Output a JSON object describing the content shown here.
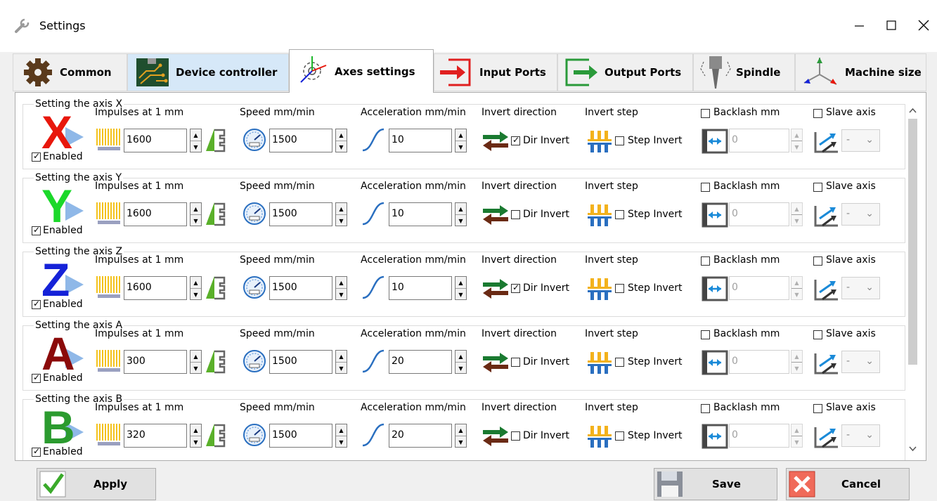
{
  "window": {
    "title": "Settings"
  },
  "tabs": [
    {
      "label": "Common",
      "icon": "gear-icon"
    },
    {
      "label": "Device controller",
      "icon": "circuit-board-icon"
    },
    {
      "label": "Axes settings",
      "icon": "axes-gear-icon"
    },
    {
      "label": "Input Ports",
      "icon": "input-arrow-icon"
    },
    {
      "label": "Output Ports",
      "icon": "output-arrow-icon"
    },
    {
      "label": "Spindle",
      "icon": "spindle-icon"
    },
    {
      "label": "Machine size",
      "icon": "machine-axes-icon"
    }
  ],
  "labels": {
    "impulses": "Impulses at 1 mm",
    "speed": "Speed mm/min",
    "acceleration": "Acceleration mm/min",
    "invert_direction": "Invert direction",
    "invert_step": "Invert step",
    "backlash": "Backlash mm",
    "slave": "Slave axis",
    "enabled": "Enabled",
    "dir_invert": "Dir Invert",
    "step_invert": "Step Invert"
  },
  "axes": [
    {
      "title": "Setting the axis X",
      "letter": "X",
      "color": "#e8170c",
      "enabled": true,
      "impulses": "1600",
      "speed": "1500",
      "acceleration": "10",
      "dir_invert": true,
      "step_invert": false,
      "backlash_checked": false,
      "backlash": "0",
      "slave_checked": false,
      "slave": "-"
    },
    {
      "title": "Setting the axis Y",
      "letter": "Y",
      "color": "#1bd82a",
      "enabled": true,
      "impulses": "1600",
      "speed": "1500",
      "acceleration": "10",
      "dir_invert": false,
      "step_invert": false,
      "backlash_checked": false,
      "backlash": "0",
      "slave_checked": false,
      "slave": "-"
    },
    {
      "title": "Setting the axis Z",
      "letter": "Z",
      "color": "#1522d8",
      "enabled": true,
      "impulses": "1600",
      "speed": "1500",
      "acceleration": "10",
      "dir_invert": true,
      "step_invert": false,
      "backlash_checked": false,
      "backlash": "0",
      "slave_checked": false,
      "slave": "-"
    },
    {
      "title": "Setting the axis A",
      "letter": "A",
      "color": "#8b0a0a",
      "enabled": true,
      "impulses": "300",
      "speed": "1500",
      "acceleration": "20",
      "dir_invert": false,
      "step_invert": false,
      "backlash_checked": false,
      "backlash": "0",
      "slave_checked": false,
      "slave": "-"
    },
    {
      "title": "Setting the axis B",
      "letter": "B",
      "color": "#2b9b2f",
      "enabled": true,
      "impulses": "320",
      "speed": "1500",
      "acceleration": "20",
      "dir_invert": false,
      "step_invert": false,
      "backlash_checked": false,
      "backlash": "0",
      "slave_checked": false,
      "slave": "-"
    }
  ],
  "footer": {
    "apply": "Apply",
    "save": "Save",
    "cancel": "Cancel"
  }
}
